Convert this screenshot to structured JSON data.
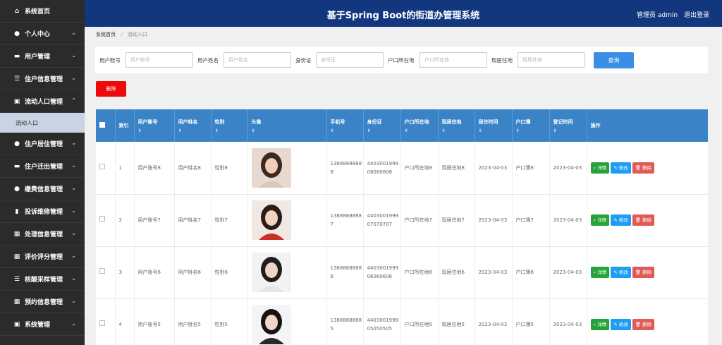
{
  "sidebar": {
    "items": [
      {
        "label": "系统首页",
        "icon": "home-icon",
        "glyph": "⌂",
        "chevron": false
      },
      {
        "label": "个人中心",
        "icon": "user-icon",
        "glyph": "●",
        "chevron": true
      },
      {
        "label": "用户管理",
        "icon": "id-card-icon",
        "glyph": "▬",
        "chevron": true
      },
      {
        "label": "住户信息管理",
        "icon": "list-icon",
        "glyph": "☰",
        "chevron": true
      },
      {
        "label": "流动人口管理",
        "icon": "clipboard-icon",
        "glyph": "▣",
        "chevron": true,
        "expanded": true
      },
      {
        "label": "住户居住管理",
        "icon": "location-icon",
        "glyph": "●",
        "chevron": true
      },
      {
        "label": "住户迁出管理",
        "icon": "briefcase-icon",
        "glyph": "▬",
        "chevron": true
      },
      {
        "label": "缴费信息管理",
        "icon": "user-icon",
        "glyph": "●",
        "chevron": true
      },
      {
        "label": "投诉维修管理",
        "icon": "bar-chart-icon",
        "glyph": "▮",
        "chevron": true
      },
      {
        "label": "处理信息管理",
        "icon": "grid-icon",
        "glyph": "▦",
        "chevron": true
      },
      {
        "label": "评价评分管理",
        "icon": "grid-icon",
        "glyph": "▦",
        "chevron": true
      },
      {
        "label": "核酸采样管理",
        "icon": "list-icon",
        "glyph": "☰",
        "chevron": true
      },
      {
        "label": "预约信息管理",
        "icon": "grid-icon",
        "glyph": "▦",
        "chevron": true
      },
      {
        "label": "系统管理",
        "icon": "calendar-icon",
        "glyph": "▣",
        "chevron": true
      }
    ],
    "subitem": "流动人口"
  },
  "header": {
    "title": "基于Spring Boot的街道办管理系统",
    "user": "管理员 admin",
    "logout": "退出登录"
  },
  "breadcrumb": {
    "home": "系统首页",
    "current": "流动人口"
  },
  "search": {
    "fields": [
      {
        "label": "用户账号",
        "placeholder": "用户账号"
      },
      {
        "label": "用户姓名",
        "placeholder": "用户姓名"
      },
      {
        "label": "身份证",
        "placeholder": "身份证"
      },
      {
        "label": "户口所在地",
        "placeholder": "户口所在地"
      },
      {
        "label": "现居住地",
        "placeholder": "现居住地"
      }
    ],
    "button": "查询"
  },
  "toolbar": {
    "delete": "删除"
  },
  "table": {
    "headers": [
      "",
      "索引",
      "用户账号",
      "用户姓名",
      "性别",
      "头像",
      "手机号",
      "身份证",
      "户口所在地",
      "现居住地",
      "居住时间",
      "户口簿",
      "登记时间",
      "操作"
    ],
    "rows": [
      {
        "index": "1",
        "account": "用户账号8",
        "name": "用户姓名8",
        "gender": "性别8",
        "phone": "13888888888",
        "id": "440300199908080808",
        "hukou": "户口所在地8",
        "residence": "现居住地8",
        "live_time": "2023-04-03",
        "booklet": "户口簿8",
        "reg_time": "2023-04-03"
      },
      {
        "index": "2",
        "account": "用户账号7",
        "name": "用户姓名7",
        "gender": "性别7",
        "phone": "13888888887",
        "id": "440300199907070707",
        "hukou": "户口所在地7",
        "residence": "现居住地7",
        "live_time": "2023-04-03",
        "booklet": "户口簿7",
        "reg_time": "2023-04-03"
      },
      {
        "index": "3",
        "account": "用户账号6",
        "name": "用户姓名6",
        "gender": "性别6",
        "phone": "13888888886",
        "id": "440300199906060606",
        "hukou": "户口所在地6",
        "residence": "现居住地6",
        "live_time": "2023-04-03",
        "booklet": "户口簿6",
        "reg_time": "2023-04-03"
      },
      {
        "index": "4",
        "account": "用户账号5",
        "name": "用户姓名5",
        "gender": "性别5",
        "phone": "13888888885",
        "id": "440300199905050505",
        "hukou": "户口所在地5",
        "residence": "现居住地5",
        "live_time": "2023-04-03",
        "booklet": "户口簿5",
        "reg_time": "2023-04-03"
      }
    ],
    "actions": {
      "detail": "详情",
      "edit": "修改",
      "delete": "删除"
    }
  }
}
